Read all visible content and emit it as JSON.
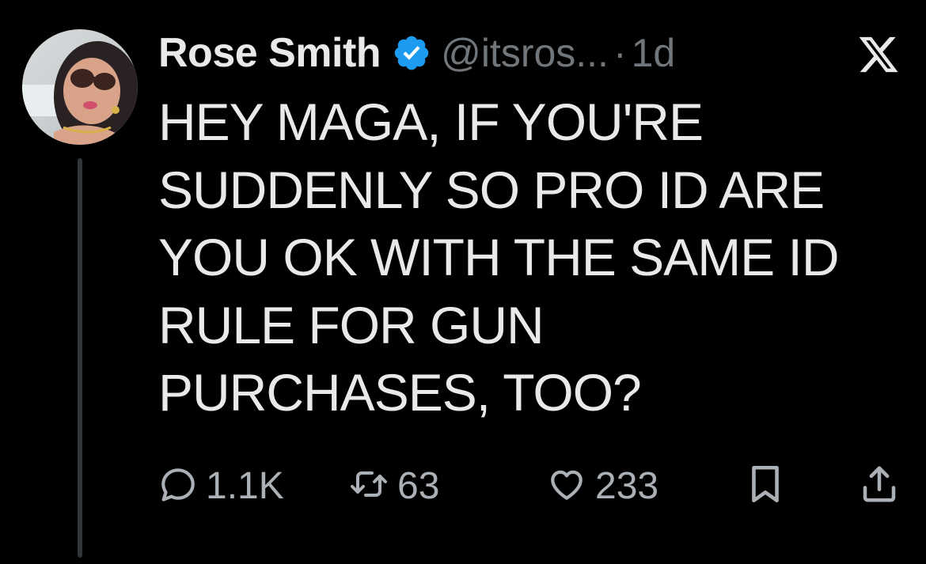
{
  "tweet": {
    "display_name": "Rose Smith",
    "verified": true,
    "handle": "@itsros...",
    "separator": "·",
    "time": "1d",
    "text": "HEY MAGA, IF YOU'RE\nSUDDENLY SO PRO ID ARE\nYOU OK WITH THE SAME ID\nRULE FOR GUN\nPURCHASES, TOO?"
  },
  "actions": {
    "replies": "1.1K",
    "retweets": "63",
    "likes": "233"
  },
  "icons": {
    "platform": "x-logo-icon",
    "verified": "verified-badge-icon",
    "reply": "reply-icon",
    "retweet": "retweet-icon",
    "like": "heart-icon",
    "bookmark": "bookmark-icon",
    "share": "share-icon"
  },
  "colors": {
    "background": "#000000",
    "primary_text": "#e7e9ea",
    "secondary_text": "#71767b",
    "verified_blue": "#1d9bf0",
    "thread_line": "#333639"
  }
}
